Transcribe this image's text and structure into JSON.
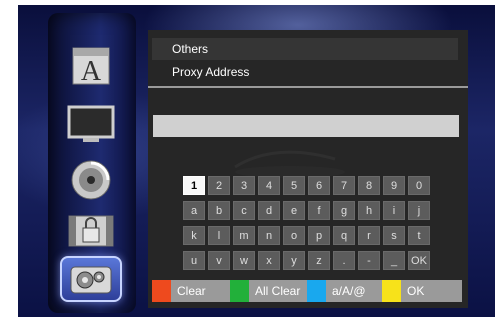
{
  "menu": {
    "rows": [
      "Others",
      "Proxy Address"
    ]
  },
  "entry_value": "",
  "keyboard": {
    "rows": [
      [
        "1",
        "2",
        "3",
        "4",
        "5",
        "6",
        "7",
        "8",
        "9",
        "0"
      ],
      [
        "a",
        "b",
        "c",
        "d",
        "e",
        "f",
        "g",
        "h",
        "i",
        "j"
      ],
      [
        "k",
        "l",
        "m",
        "n",
        "o",
        "p",
        "q",
        "r",
        "s",
        "t"
      ],
      [
        "u",
        "v",
        "w",
        "x",
        "y",
        "z",
        ".",
        "-",
        "_",
        "OK"
      ]
    ],
    "selected": "1"
  },
  "legend": [
    {
      "label": "Clear",
      "color": "#ee4a1e"
    },
    {
      "label": "All Clear",
      "color": "#22b03a"
    },
    {
      "label": "a/A/@",
      "color": "#19a8ee"
    },
    {
      "label": "OK",
      "color": "#f7e21a"
    }
  ],
  "sidebar_icons": [
    "font-icon",
    "tv-screen-icon",
    "disc-icon",
    "parental-lock-icon",
    "settings-gears-icon"
  ],
  "selected_sidebar_icon": "settings-gears-icon"
}
